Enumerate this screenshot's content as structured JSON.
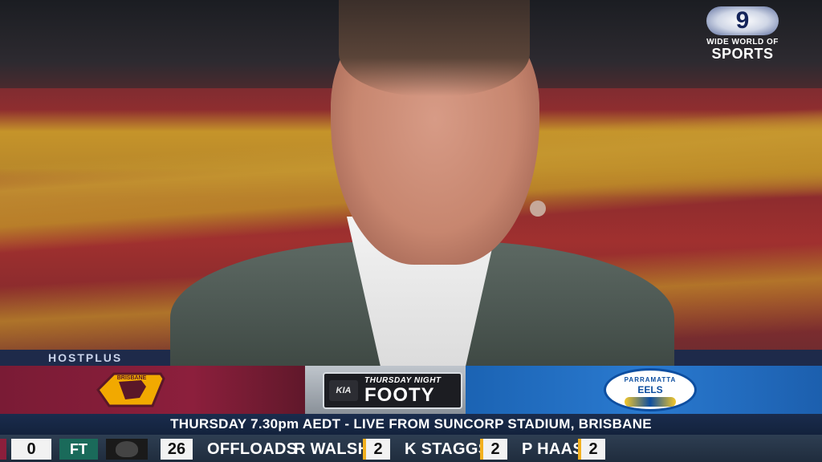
{
  "network": {
    "logo_mark": "9",
    "line1": "WIDE WORLD OF",
    "line2": "SPORTS"
  },
  "scene": {
    "adboard_text": "HOSTPLUS"
  },
  "show": {
    "sponsor": "KIA",
    "title_small": "THURSDAY NIGHT",
    "title_large": "FOOTY",
    "home_team": "BRISBANE",
    "away_team_line1": "PARRAMATTA",
    "away_team_line2": "EELS"
  },
  "info_bar": {
    "text": "THURSDAY 7.30pm AEDT - LIVE FROM SUNCORP STADIUM, BRISBANE"
  },
  "ticker": {
    "home_score": "0",
    "status": "FT",
    "away_score": "26",
    "stat_label": "OFFLOADS",
    "players": [
      {
        "name": "R WALSH",
        "value": "2"
      },
      {
        "name": "K STAGGS",
        "value": "2"
      },
      {
        "name": "P HAAS",
        "value": "2"
      }
    ]
  },
  "colors": {
    "home": "#8c1f3c",
    "away": "#1c5fae",
    "accent": "#f2b01e"
  }
}
